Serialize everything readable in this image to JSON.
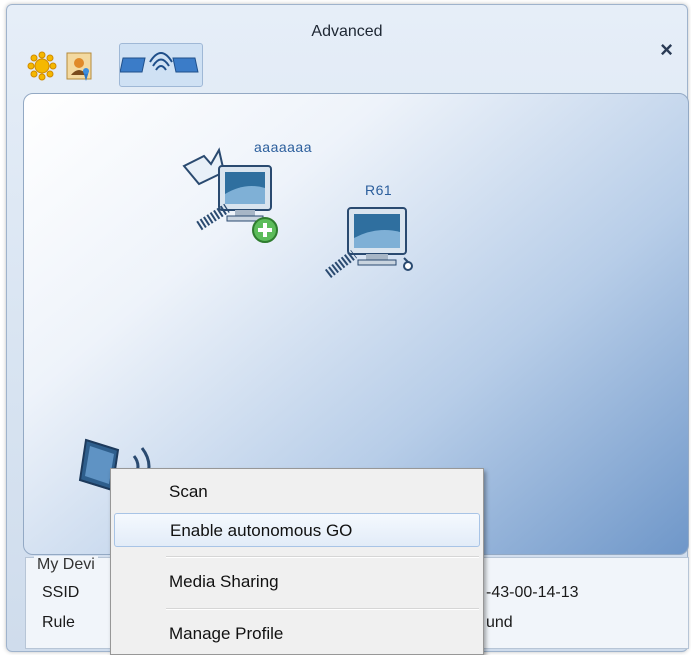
{
  "window": {
    "title": "Advanced",
    "close_label": "×"
  },
  "toolbar": {
    "items": [
      {
        "icon": "settings-sun-icon"
      },
      {
        "icon": "profile-certificate-icon"
      },
      {
        "icon": "wifi-direct-icon",
        "selected": true
      }
    ]
  },
  "devices": [
    {
      "name": "aaaaaaa",
      "icon": "group-owner-computer-icon"
    },
    {
      "name": "R61",
      "icon": "client-computer-icon"
    }
  ],
  "my_device": {
    "title": "My Devi",
    "rows": [
      {
        "label": "SSID",
        "value": "-43-00-14-13"
      },
      {
        "label": "Rule",
        "value": "und"
      }
    ]
  },
  "context_menu": {
    "items": [
      {
        "label": "Scan",
        "highlighted": false
      },
      {
        "label": "Enable autonomous GO",
        "highlighted": true
      },
      {
        "label": "Media Sharing",
        "highlighted": false
      },
      {
        "label": "Manage Profile",
        "highlighted": false
      }
    ]
  },
  "colors": {
    "accent": "#2b5e9c",
    "menu_bg": "#f0f0f0",
    "highlight": "#e2ecf8"
  }
}
